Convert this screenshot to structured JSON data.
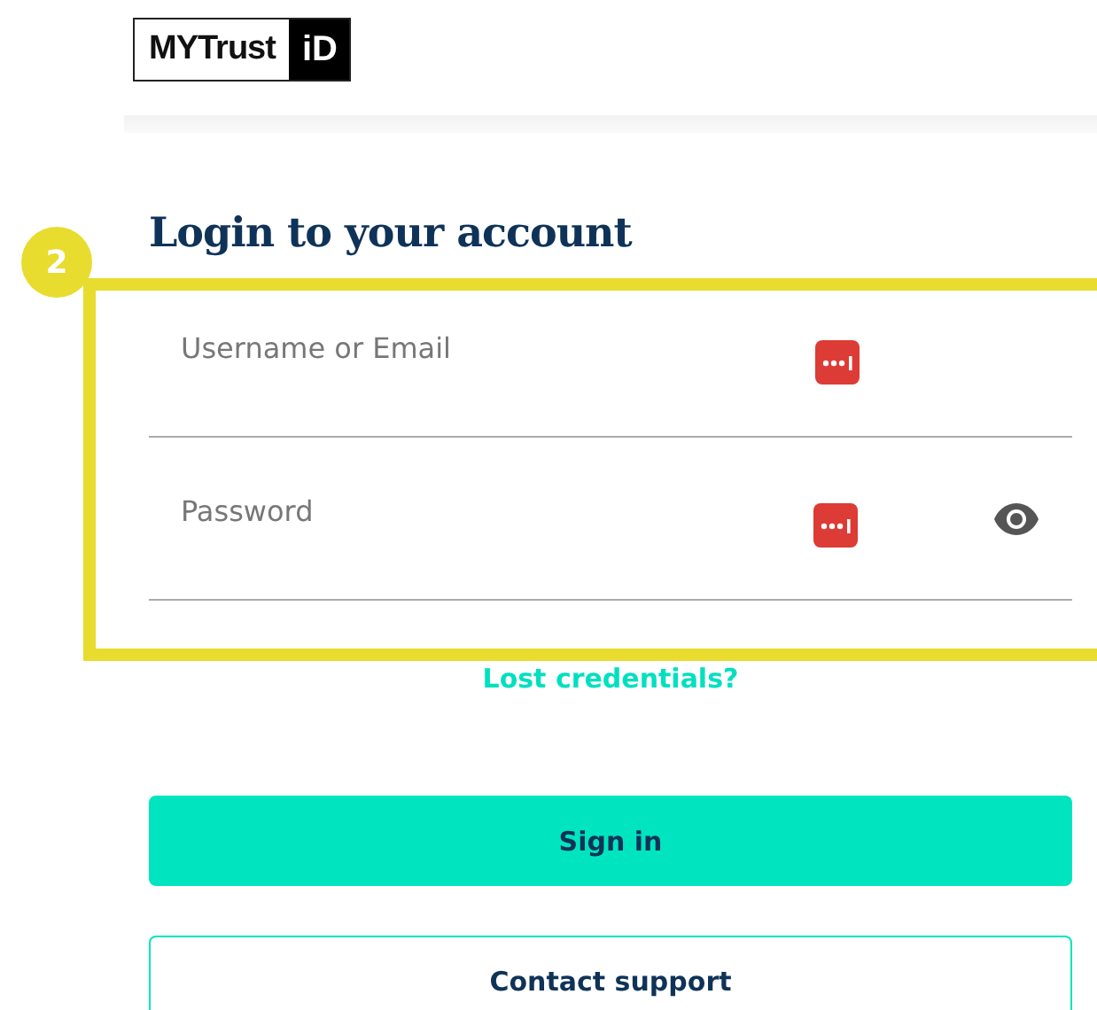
{
  "logo": {
    "word": "MYTrust",
    "mark": "iD"
  },
  "title": "Login to your account",
  "highlight": {
    "number": "2"
  },
  "fields": [
    {
      "placeholder": "Username or Email",
      "reveal": false
    },
    {
      "placeholder": "Password",
      "reveal": true
    }
  ],
  "link": "Lost credentials?",
  "buttons": [
    {
      "label": "Sign in",
      "kind": "primary"
    },
    {
      "label": "Contact support",
      "kind": "outline"
    }
  ]
}
